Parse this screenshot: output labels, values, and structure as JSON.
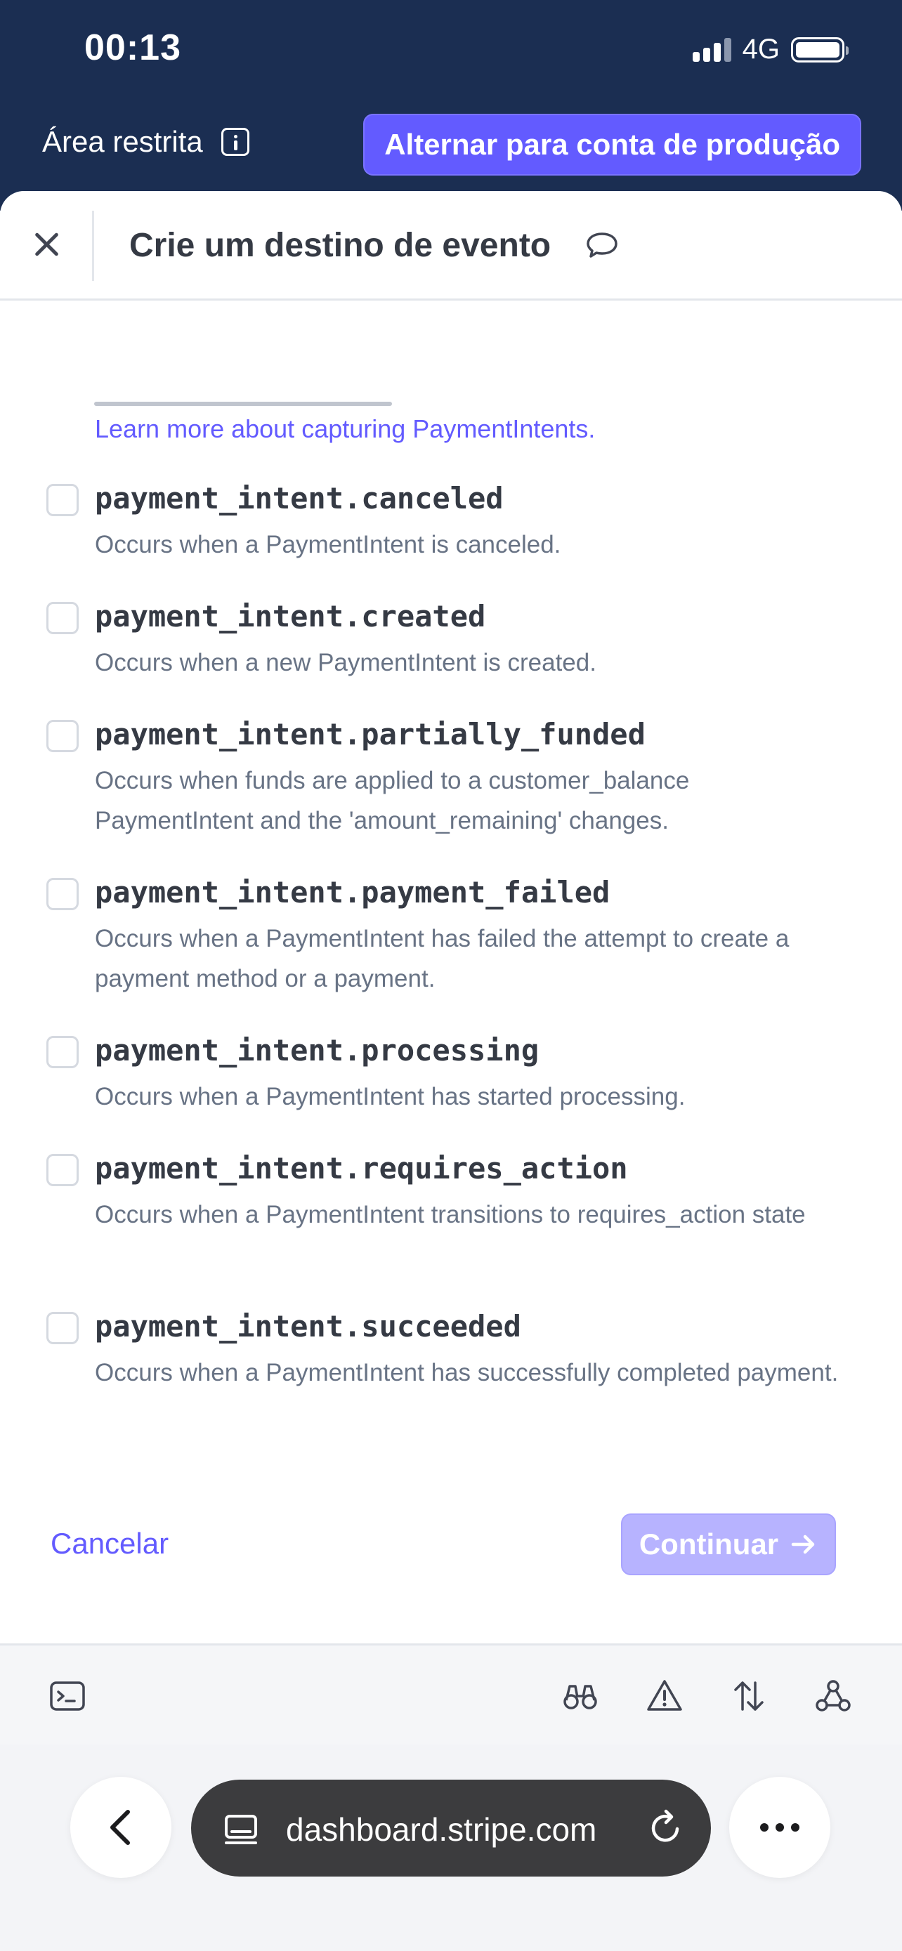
{
  "status_bar": {
    "time": "00:13",
    "network": "4G"
  },
  "banner": {
    "sandbox_label": "Área restrita",
    "switch_button": "Alternar para conta de produção"
  },
  "sheet": {
    "title": "Crie um destino de evento",
    "learn_link": "Learn more about capturing PaymentIntents.",
    "events": [
      {
        "name": "payment_intent.canceled",
        "description": "Occurs when a PaymentIntent is canceled.",
        "checked": false
      },
      {
        "name": "payment_intent.created",
        "description": "Occurs when a new PaymentIntent is created.",
        "checked": false
      },
      {
        "name": "payment_intent.partially_funded",
        "description": "Occurs when funds are applied to a customer_balance PaymentIntent and the 'amount_remaining' changes.",
        "checked": false
      },
      {
        "name": "payment_intent.payment_failed",
        "description": "Occurs when a PaymentIntent has failed the attempt to create a payment method or a payment.",
        "checked": false
      },
      {
        "name": "payment_intent.processing",
        "description": "Occurs when a PaymentIntent has started processing.",
        "checked": false
      },
      {
        "name": "payment_intent.requires_action",
        "description": "Occurs when a PaymentIntent transitions to requires_action state",
        "checked": false
      },
      {
        "name": "payment_intent.succeeded",
        "description": "Occurs when a PaymentIntent has successfully completed payment.",
        "checked": false
      }
    ],
    "cancel_label": "Cancelar",
    "continue_label": "Continuar"
  },
  "dev_toolbar": {
    "icons": [
      "terminal-icon",
      "binoculars-icon",
      "warning-icon",
      "sort-arrows-icon",
      "webhook-icon"
    ]
  },
  "browser": {
    "url": "dashboard.stripe.com"
  },
  "colors": {
    "banner_bg": "#1b2e52",
    "accent": "#635bff",
    "continue_disabled": "#b7b3ff"
  }
}
